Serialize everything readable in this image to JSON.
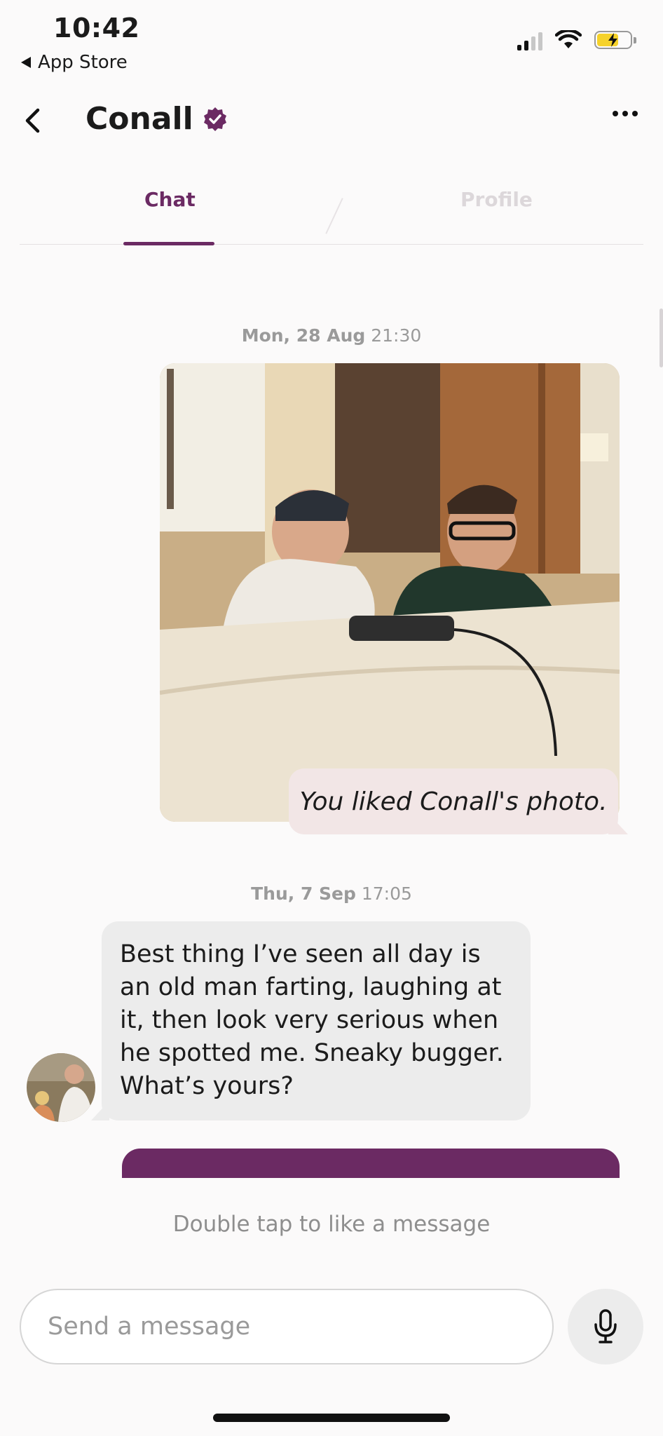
{
  "status_bar": {
    "time": "10:42",
    "back_app_label": "App Store"
  },
  "header": {
    "name": "Conall"
  },
  "tabs": [
    {
      "label": "Chat"
    },
    {
      "label": "Profile"
    }
  ],
  "messages": {
    "timestamp1_date": "Mon, 28 Aug",
    "timestamp1_time": "21:30",
    "photo_like_text": "You liked Conall's photo.",
    "timestamp2_date": "Thu, 7 Sep",
    "timestamp2_time": "17:05",
    "received_text": "Best thing I’ve seen all day is an old man farting, laughing at it, then look very serious when he spotted me. Sneaky bugger. What’s yours?"
  },
  "hint": "Double tap to like a message",
  "composer": {
    "placeholder": "Send a message"
  },
  "colors": {
    "accent": "#6b2a63",
    "like_bubble": "#f2e6e6",
    "received_bubble": "#ececec"
  }
}
